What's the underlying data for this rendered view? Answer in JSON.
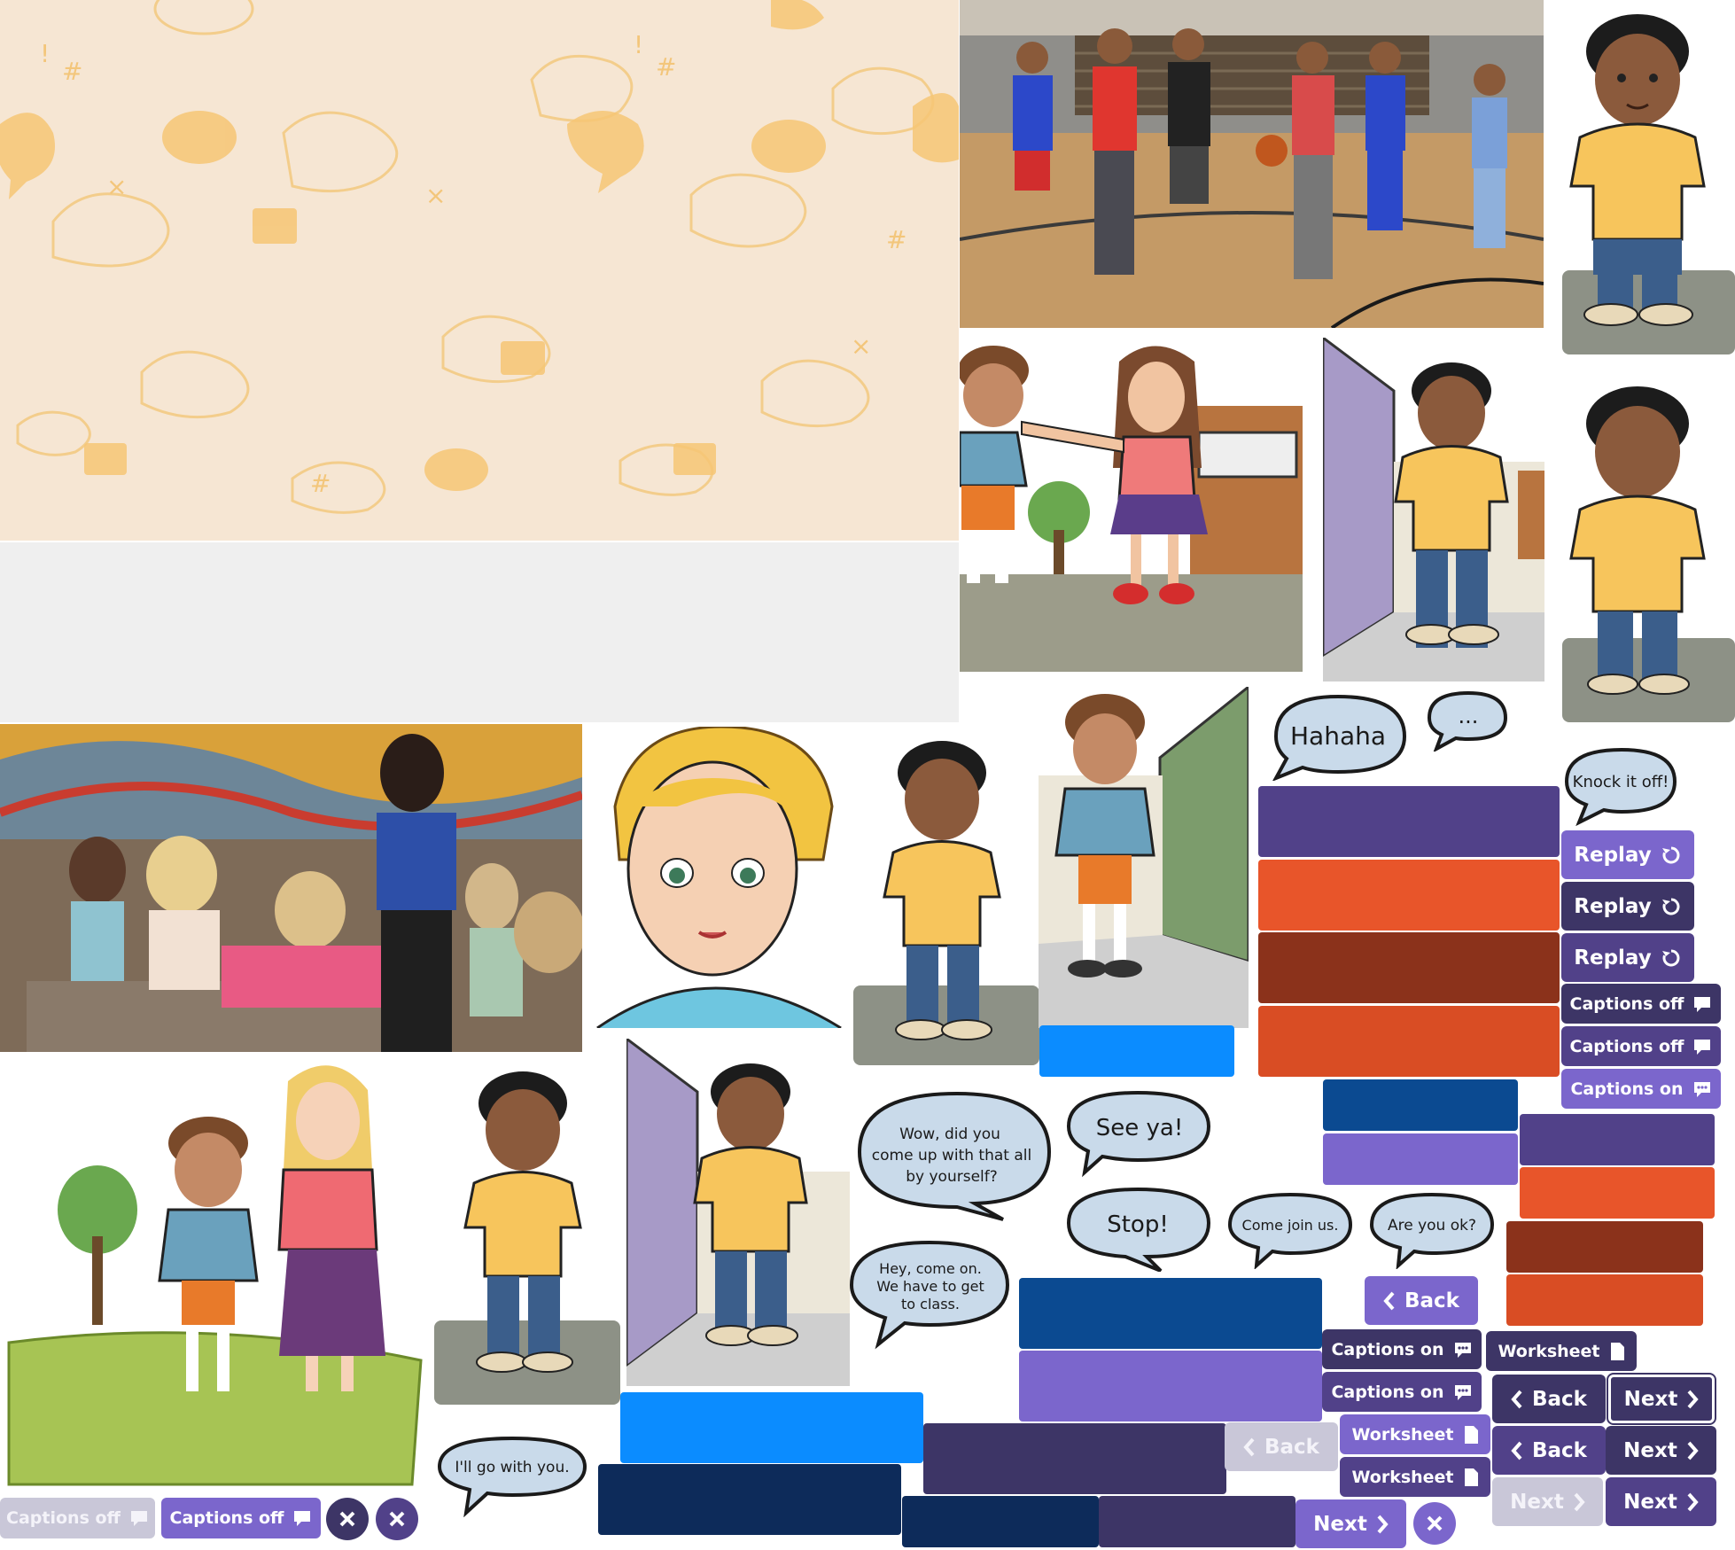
{
  "bubbles": {
    "hahaha": "Hahaha",
    "ellipsis": "...",
    "knock_it_off": "Knock it off!",
    "wow_line1": "Wow, did you",
    "wow_line2": "come up with that all",
    "wow_line3": "by yourself?",
    "see_ya": "See ya!",
    "stop": "Stop!",
    "come_join": "Come join us.",
    "are_you_ok": "Are you ok?",
    "hey_line1": "Hey, come on.",
    "hey_line2": "We have to get",
    "hey_line3": "to class.",
    "ill_go": "I'll go with you."
  },
  "buttons": {
    "replay": "Replay",
    "captions_off": "Captions off",
    "captions_on": "Captions on",
    "worksheet": "Worksheet",
    "back": "Back",
    "next": "Next"
  },
  "colors": {
    "purple_dark": "#3d3566",
    "purple_mid": "#514189",
    "purple_light": "#7b66cc",
    "orange": "#e8552a",
    "rust": "#8b321b",
    "orange2": "#d94d24",
    "navy": "#0b4a91",
    "navy_dark": "#0d2b5a",
    "blue_bright": "#0b8cff",
    "disabled": "#c9c7d8",
    "pattern_bg": "#f6e6d3",
    "pattern_fg": "#f6c674"
  }
}
